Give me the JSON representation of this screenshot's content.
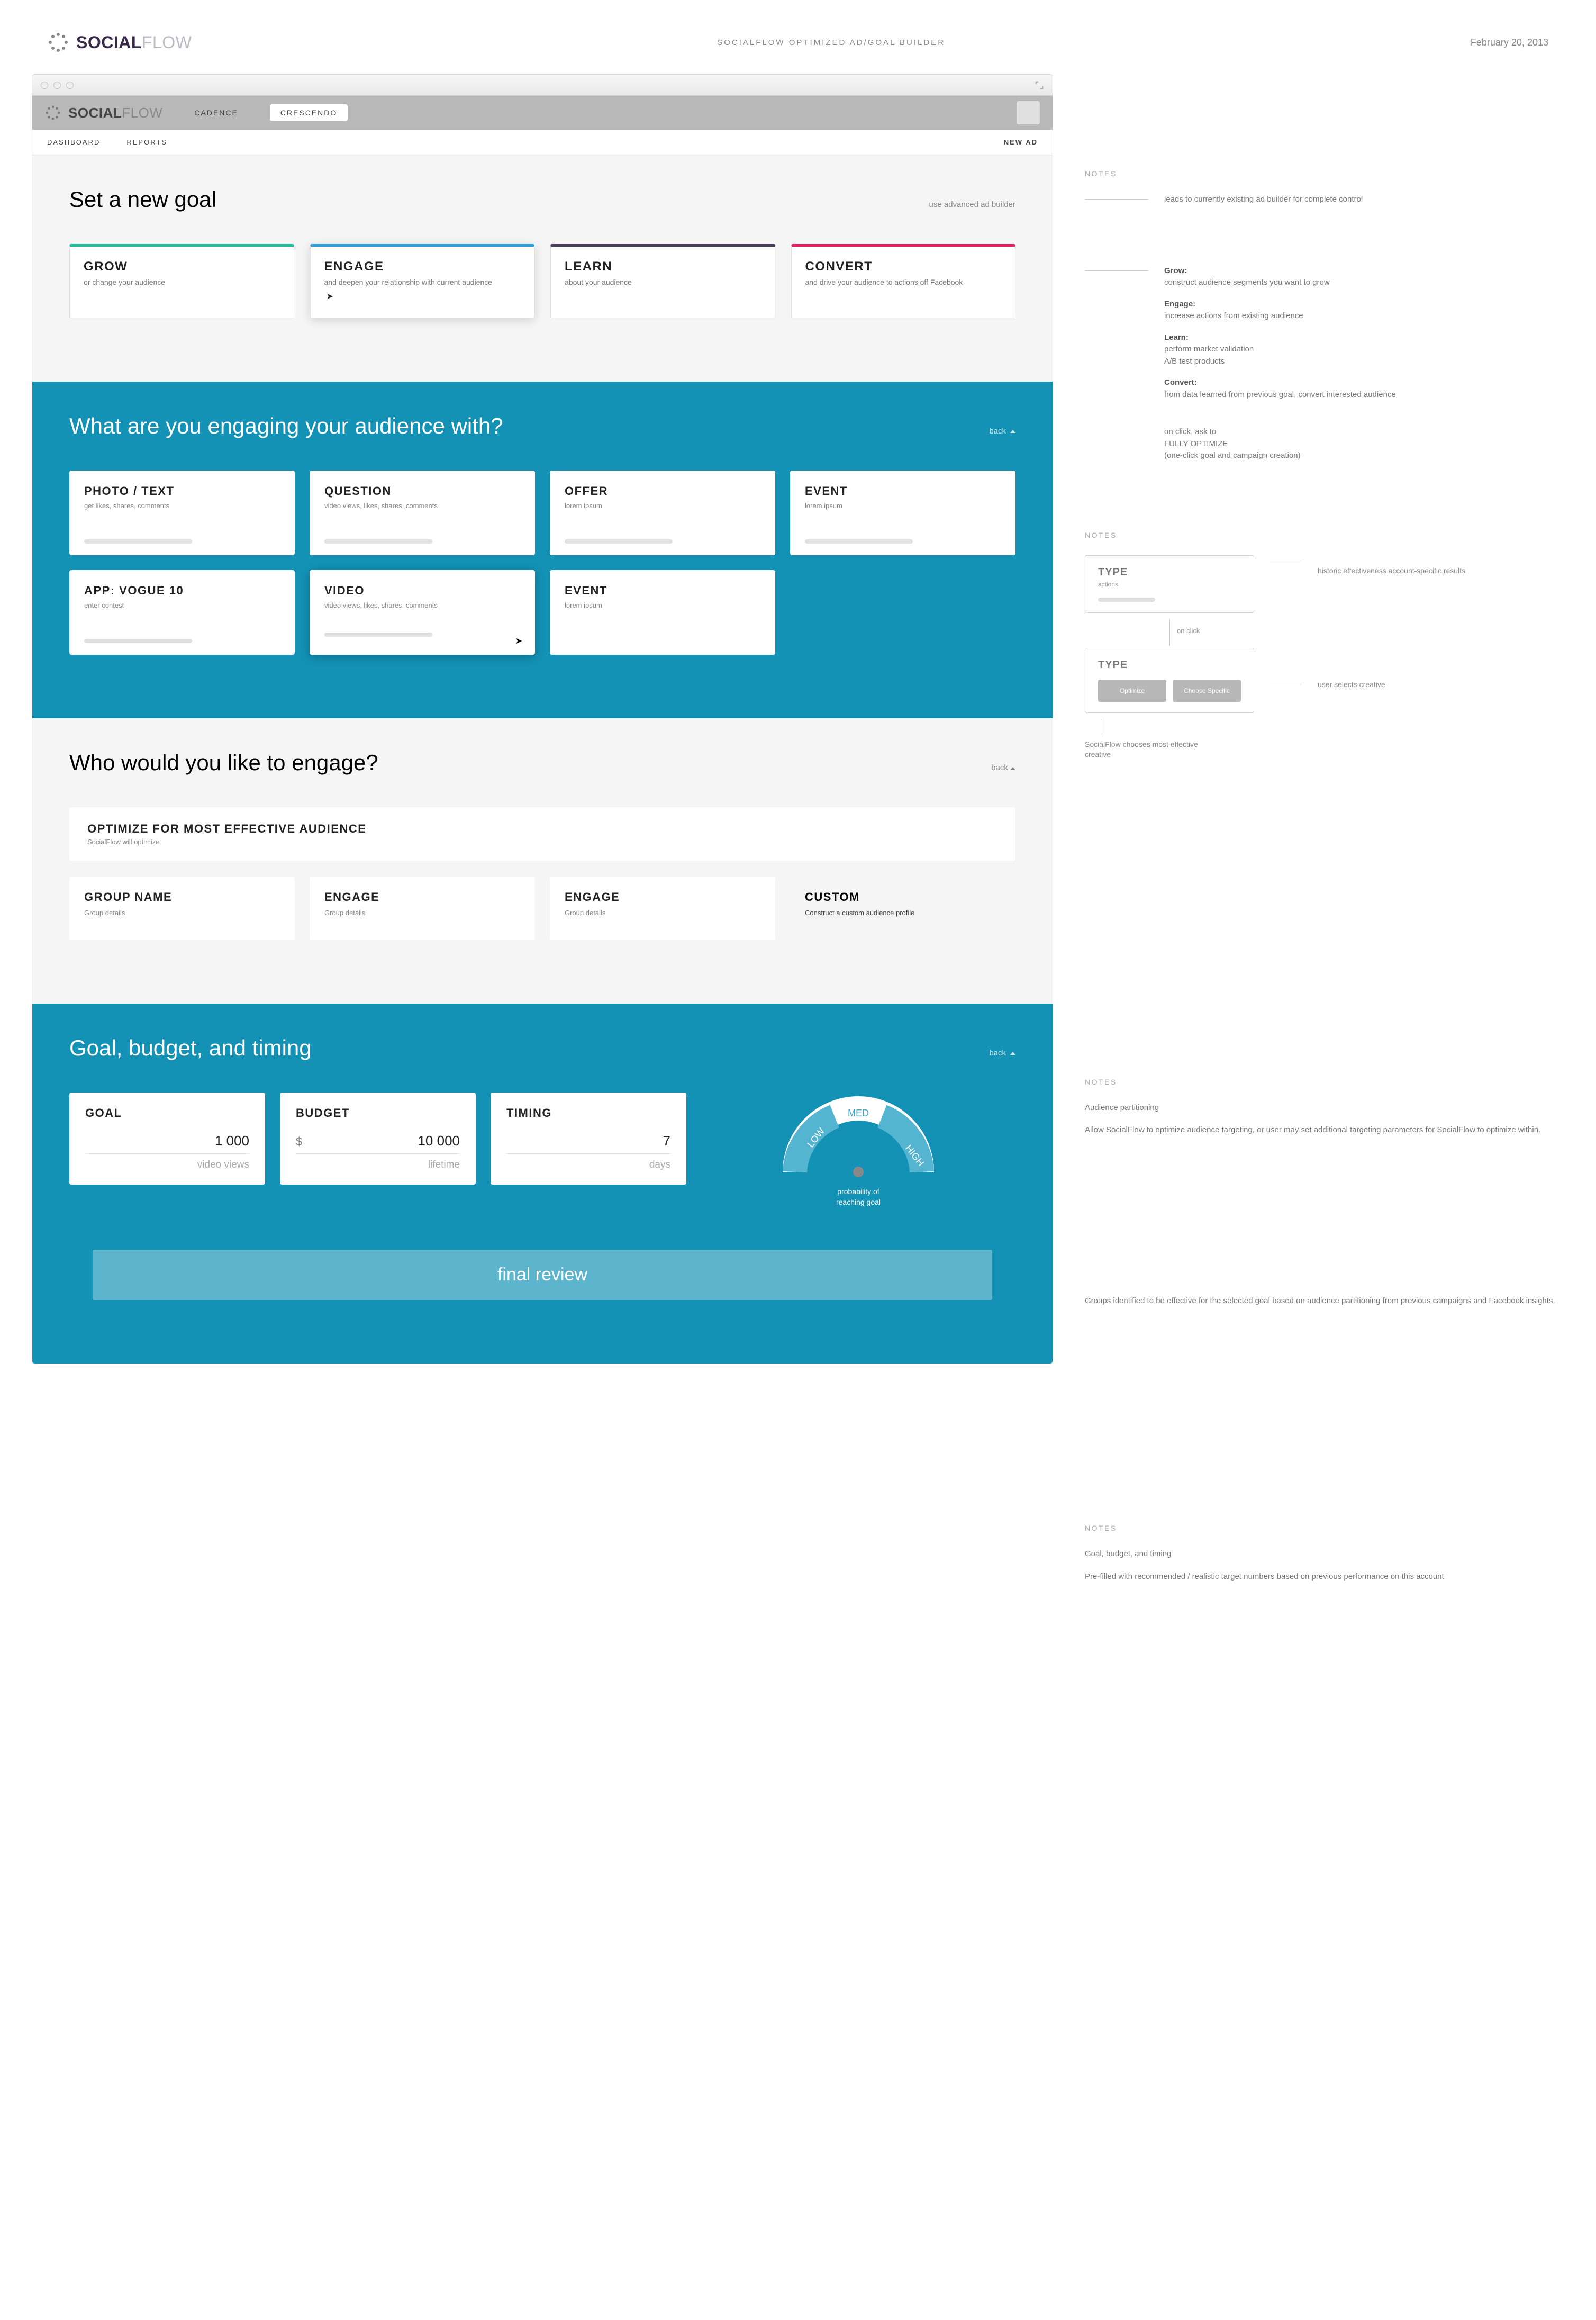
{
  "header": {
    "brand_primary": "SOCIAL",
    "brand_secondary": "FLOW",
    "page_title": "SOCIALFLOW OPTIMIZED AD/GOAL BUILDER",
    "date": "February 20, 2013"
  },
  "app_nav": {
    "tabs": [
      "CADENCE",
      "CRESCENDO"
    ],
    "active_tab": "CRESCENDO",
    "sub_links": [
      "DASHBOARD",
      "REPORTS"
    ],
    "new_ad": "NEW AD"
  },
  "section1": {
    "title": "Set a new goal",
    "advanced_link": "use advanced ad builder",
    "cards": [
      {
        "key": "grow",
        "title": "GROW",
        "sub": "or change your audience"
      },
      {
        "key": "engage",
        "title": "ENGAGE",
        "sub": "and deepen your relationship with current audience",
        "active": true
      },
      {
        "key": "learn",
        "title": "LEARN",
        "sub": "about your audience"
      },
      {
        "key": "convert",
        "title": "CONVERT",
        "sub": "and drive your audience to actions off Facebook"
      }
    ]
  },
  "section2": {
    "title": "What are you engaging your audience with?",
    "back": "back",
    "cards": [
      {
        "title": "PHOTO / TEXT",
        "sub": "get likes, shares, comments"
      },
      {
        "title": "QUESTION",
        "sub": "video views, likes, shares, comments"
      },
      {
        "title": "OFFER",
        "sub": "lorem ipsum"
      },
      {
        "title": "EVENT",
        "sub": "lorem ipsum"
      },
      {
        "title": "APP: VOGUE 10",
        "sub": "enter contest"
      },
      {
        "title": "VIDEO",
        "sub": "video views, likes, shares, comments",
        "selected": true
      },
      {
        "title": "EVENT",
        "sub": "lorem ipsum",
        "nobar": true
      }
    ]
  },
  "section3": {
    "title": "Who would you like to engage?",
    "back": "back",
    "optimize": {
      "title": "OPTIMIZE FOR MOST EFFECTIVE AUDIENCE",
      "sub": "SocialFlow will optimize"
    },
    "cards": [
      {
        "title": "GROUP NAME",
        "sub": "Group details"
      },
      {
        "title": "ENGAGE",
        "sub": "Group details"
      },
      {
        "title": "ENGAGE",
        "sub": "Group details"
      },
      {
        "title": "CUSTOM",
        "sub": "Construct a custom audience profile",
        "custom": true
      }
    ]
  },
  "section4": {
    "title": "Goal, budget, and timing",
    "back": "back",
    "goal": {
      "label": "GOAL",
      "value": "1 000",
      "unit": "video views"
    },
    "budget": {
      "label": "BUDGET",
      "prefix": "$",
      "value": "10 000",
      "unit": "lifetime"
    },
    "timing": {
      "label": "TIMING",
      "value": "7",
      "unit": "days"
    },
    "gauge": {
      "low": "LOW",
      "med": "MED",
      "high": "HIGH",
      "caption1": "probability of",
      "caption2": "reaching goal"
    },
    "final_review": "final review"
  },
  "notes": {
    "label": "NOTES",
    "block1_lead": "leads to currently existing ad builder for complete control",
    "block1_items": [
      {
        "h": "Grow:",
        "t": "construct audience segments you want to grow"
      },
      {
        "h": "Engage:",
        "t": "increase actions from existing audience"
      },
      {
        "h": "Learn:",
        "t": "perform market validation\nA/B test products"
      },
      {
        "h": "Convert:",
        "t": "from data learned from previous goal, convert interested audience"
      }
    ],
    "block1_tail1": "on click, ask to",
    "block1_tail2": "FULLY OPTIMIZE",
    "block1_tail3": "(one-click goal and campaign creation)",
    "type_diagram": {
      "type_label": "TYPE",
      "actions": "actions",
      "side1": "historic effectiveness account-specific results",
      "on_click": "on click",
      "btn_optimize": "Optimize",
      "btn_choose": "Choose Specific",
      "side2": "user selects creative",
      "branch1": "SocialFlow chooses most effective creative"
    },
    "block3_heading": "Audience partitioning",
    "block3_p1": "Allow SocialFlow to optimize audience targeting, or user may set additional targeting parameters for SocialFlow to optimize within.",
    "block3_p2": "Groups identified to be effective for the selected goal based on audience partitioning from previous campaigns and Facebook insights.",
    "block4_heading": "Goal, budget, and timing",
    "block4_p1": "Pre-filled with recommended / realistic target numbers based on previous performance on this account"
  }
}
